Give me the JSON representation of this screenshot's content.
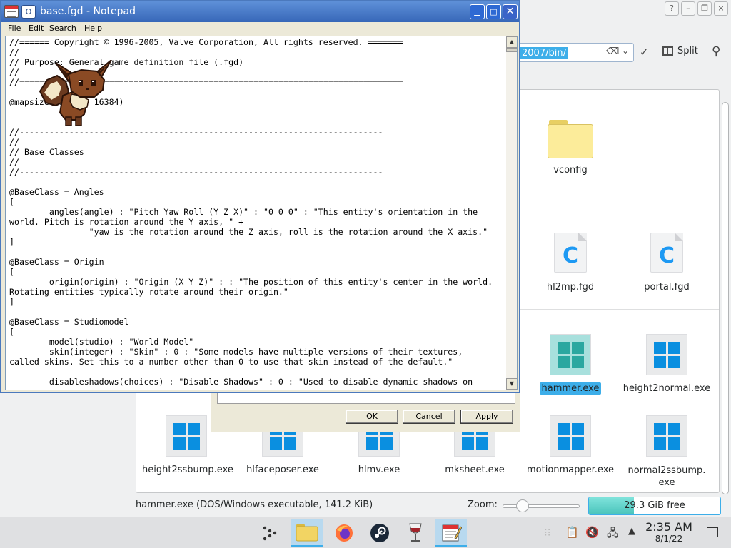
{
  "dolphin": {
    "title_buttons": [
      "?",
      "–",
      "❐",
      "×"
    ],
    "path_selected": "2007/bin/",
    "split_label": "Split",
    "files": [
      {
        "name": "vconfig",
        "type": "folder"
      },
      {
        "name": "hl2mp.fgd",
        "type": "c"
      },
      {
        "name": "portal.fgd",
        "type": "c"
      },
      {
        "name": "hammer.exe",
        "type": "exe",
        "selected": true
      },
      {
        "name": "height2normal.exe",
        "type": "exe"
      },
      {
        "name": "height2ssbump.exe",
        "type": "exe"
      },
      {
        "name": "hlfaceposer.exe",
        "type": "exe"
      },
      {
        "name": "hlmv.exe",
        "type": "exe"
      },
      {
        "name": "mksheet.exe",
        "type": "exe"
      },
      {
        "name": "motionmapper.exe",
        "type": "exe"
      },
      {
        "name": "normal2ssbump.\nexe",
        "type": "exe"
      }
    ],
    "status_text": "hammer.exe (DOS/Windows executable, 141.2 KiB)",
    "zoom_label": "Zoom:",
    "free_space": "29.3 GiB free",
    "free_fraction": 0.34
  },
  "dialog": {
    "ok": "OK",
    "cancel": "Cancel",
    "apply": "Apply"
  },
  "notepad": {
    "title": "base.fgd - Notepad",
    "menu": [
      "File",
      "Edit",
      "Search",
      "Help"
    ],
    "content": "//====== Copyright © 1996-2005, Valve Corporation, All rights reserved. =======\n//\n// Purpose: General game definition file (.fgd)\n//\n//=============================================================================\n\n@mapsize(-16384, 16384)\n\n\n//-------------------------------------------------------------------------\n//\n// Base Classes\n//\n//-------------------------------------------------------------------------\n\n@BaseClass = Angles\n[\n        angles(angle) : \"Pitch Yaw Roll (Y Z X)\" : \"0 0 0\" : \"This entity's orientation in the\nworld. Pitch is rotation around the Y axis, \" +\n                \"yaw is the rotation around the Z axis, roll is the rotation around the X axis.\"\n]\n\n@BaseClass = Origin\n[\n        origin(origin) : \"Origin (X Y Z)\" : : \"The position of this entity's center in the world.\nRotating entities typically rotate around their origin.\"\n]\n\n@BaseClass = Studiomodel\n[\n        model(studio) : \"World Model\"\n        skin(integer) : \"Skin\" : 0 : \"Some models have multiple versions of their textures,\ncalled skins. Set this to a number other than 0 to use that skin instead of the default.\"\n\n        disableshadows(choices) : \"Disable Shadows\" : 0 : \"Used to disable dynamic shadows on"
  },
  "taskbar": {
    "time": "2:35 AM",
    "date": "8/1/22"
  }
}
